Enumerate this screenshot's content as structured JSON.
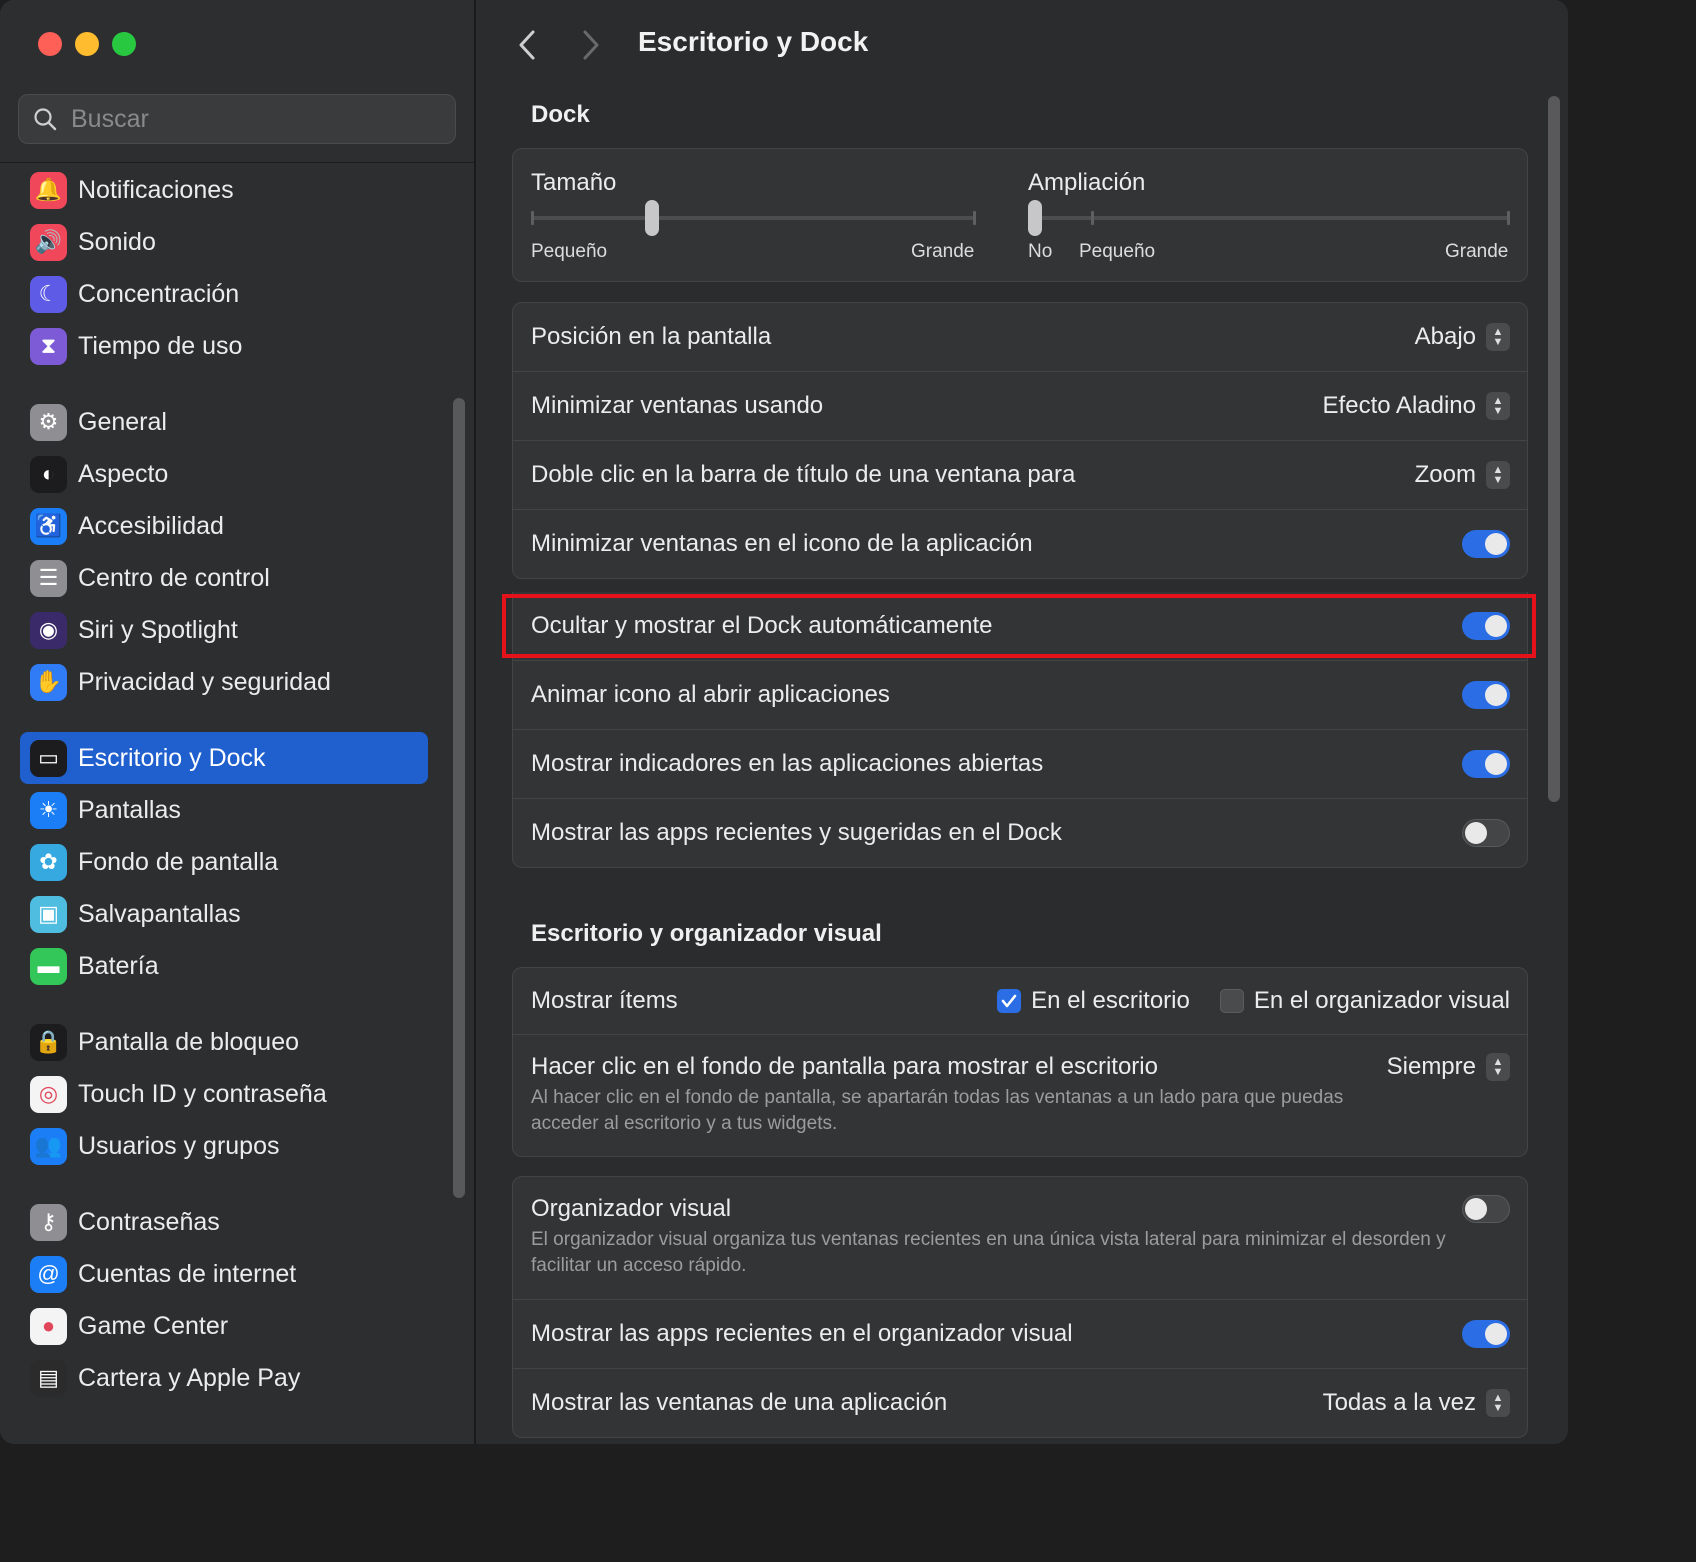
{
  "window": {
    "title": "Escritorio y Dock"
  },
  "sidebar": {
    "search_placeholder": "Buscar",
    "groups": [
      [
        {
          "label": "Notificaciones",
          "icon": "bell-icon",
          "color": "#f0475a"
        },
        {
          "label": "Sonido",
          "icon": "speaker-icon",
          "color": "#f0475a"
        },
        {
          "label": "Concentración",
          "icon": "moon-icon",
          "color": "#5e5ce6"
        },
        {
          "label": "Tiempo de uso",
          "icon": "hourglass-icon",
          "color": "#7d5bd6"
        }
      ],
      [
        {
          "label": "General",
          "icon": "gear-icon",
          "color": "#8e8e93"
        },
        {
          "label": "Aspecto",
          "icon": "appearance-icon",
          "color": "#1c1c1e"
        },
        {
          "label": "Accesibilidad",
          "icon": "accessibility-icon",
          "color": "#1b7ef6"
        },
        {
          "label": "Centro de control",
          "icon": "control-center-icon",
          "color": "#8e8e93"
        },
        {
          "label": "Siri y Spotlight",
          "icon": "siri-icon",
          "color": "#3a2a6a"
        },
        {
          "label": "Privacidad y seguridad",
          "icon": "hand-icon",
          "color": "#2f7cf6"
        }
      ],
      [
        {
          "label": "Escritorio y Dock",
          "icon": "dock-icon",
          "color": "#1c1c1e",
          "selected": true
        },
        {
          "label": "Pantallas",
          "icon": "sun-icon",
          "color": "#1b7ef6"
        },
        {
          "label": "Fondo de pantalla",
          "icon": "flower-icon",
          "color": "#36a9e0"
        },
        {
          "label": "Salvapantallas",
          "icon": "screensaver-icon",
          "color": "#4fbde0"
        },
        {
          "label": "Batería",
          "icon": "battery-icon",
          "color": "#33c659"
        }
      ],
      [
        {
          "label": "Pantalla de bloqueo",
          "icon": "lock-icon",
          "color": "#1c1c1e"
        },
        {
          "label": "Touch ID y contraseña",
          "icon": "fingerprint-icon",
          "color": "#f4f4f4"
        },
        {
          "label": "Usuarios y grupos",
          "icon": "users-icon",
          "color": "#1b7ef6"
        }
      ],
      [
        {
          "label": "Contraseñas",
          "icon": "key-icon",
          "color": "#8e8e93"
        },
        {
          "label": "Cuentas de internet",
          "icon": "at-icon",
          "color": "#1b7ef6"
        },
        {
          "label": "Game Center",
          "icon": "game-center-icon",
          "color": "#f4f4f4"
        },
        {
          "label": "Cartera y Apple Pay",
          "icon": "wallet-icon",
          "color": "#2b2b2b"
        }
      ]
    ]
  },
  "main": {
    "title": "Escritorio y Dock",
    "dock": {
      "section_title": "Dock",
      "size": {
        "label": "Tamaño",
        "min_label": "Pequeño",
        "max_label": "Grande",
        "value": 0.27
      },
      "magnification": {
        "label": "Ampliación",
        "off_label": "No",
        "min_label": "Pequeño",
        "max_label": "Grande",
        "value": 0.0
      },
      "rows": [
        {
          "label": "Posición en la pantalla",
          "value": "Abajo"
        },
        {
          "label": "Minimizar ventanas usando",
          "value": "Efecto Aladino"
        },
        {
          "label": "Doble clic en la barra de título de una ventana para",
          "value": "Zoom"
        },
        {
          "label": "Minimizar ventanas en el icono de la aplicación",
          "toggle": true
        }
      ],
      "rows2": [
        {
          "label": "Ocultar y mostrar el Dock automáticamente",
          "toggle": true
        },
        {
          "label": "Animar icono al abrir aplicaciones",
          "toggle": true
        },
        {
          "label": "Mostrar indicadores en las aplicaciones abiertas",
          "toggle": true
        },
        {
          "label": "Mostrar las apps recientes y sugeridas en el Dock",
          "toggle": false
        }
      ]
    },
    "desktop": {
      "section_title": "Escritorio y organizador visual",
      "show_items": {
        "label": "Mostrar ítems",
        "desktop_label": "En el escritorio",
        "desktop_checked": true,
        "stage_label": "En el organizador visual",
        "stage_checked": false
      },
      "click_wallpaper": {
        "label": "Hacer clic en el fondo de pantalla para mostrar el escritorio",
        "value": "Siempre",
        "description": "Al hacer clic en el fondo de pantalla, se apartarán todas las ventanas a un lado para que puedas acceder al escritorio y a tus widgets."
      },
      "stage_manager": {
        "label": "Organizador visual",
        "toggle": false,
        "description": "El organizador visual organiza tus ventanas recientes en una única vista lateral para minimizar el desorden y facilitar un acceso rápido."
      },
      "recent_apps": {
        "label": "Mostrar las apps recientes en el organizador visual",
        "toggle": true
      },
      "app_windows": {
        "label": "Mostrar las ventanas de una aplicación",
        "value": "Todas a la vez"
      }
    }
  }
}
